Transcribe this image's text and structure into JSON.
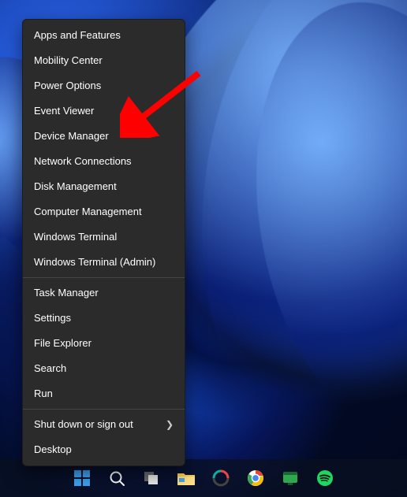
{
  "menu": {
    "group1": [
      {
        "label": "Apps and Features",
        "name": "menu-apps-features"
      },
      {
        "label": "Mobility Center",
        "name": "menu-mobility-center"
      },
      {
        "label": "Power Options",
        "name": "menu-power-options"
      },
      {
        "label": "Event Viewer",
        "name": "menu-event-viewer"
      },
      {
        "label": "Device Manager",
        "name": "menu-device-manager"
      },
      {
        "label": "Network Connections",
        "name": "menu-network-connections"
      },
      {
        "label": "Disk Management",
        "name": "menu-disk-management"
      },
      {
        "label": "Computer Management",
        "name": "menu-computer-management"
      },
      {
        "label": "Windows Terminal",
        "name": "menu-windows-terminal"
      },
      {
        "label": "Windows Terminal (Admin)",
        "name": "menu-windows-terminal-admin"
      }
    ],
    "group2": [
      {
        "label": "Task Manager",
        "name": "menu-task-manager"
      },
      {
        "label": "Settings",
        "name": "menu-settings"
      },
      {
        "label": "File Explorer",
        "name": "menu-file-explorer"
      },
      {
        "label": "Search",
        "name": "menu-search"
      },
      {
        "label": "Run",
        "name": "menu-run"
      }
    ],
    "group3": [
      {
        "label": "Shut down or sign out",
        "name": "menu-shutdown-signout",
        "submenu": true
      },
      {
        "label": "Desktop",
        "name": "menu-desktop"
      }
    ]
  },
  "taskbar": {
    "items": [
      {
        "name": "start-button",
        "icon": "windows-icon"
      },
      {
        "name": "search-button",
        "icon": "search-icon"
      },
      {
        "name": "task-view-button",
        "icon": "task-view-icon"
      },
      {
        "name": "file-explorer-button",
        "icon": "folder-icon"
      },
      {
        "name": "app-button-1",
        "icon": "ring-icon"
      },
      {
        "name": "chrome-button",
        "icon": "chrome-icon"
      },
      {
        "name": "app-button-2",
        "icon": "green-panel-icon"
      },
      {
        "name": "spotify-button",
        "icon": "spotify-icon"
      }
    ]
  },
  "annotation": {
    "target": "menu-device-manager",
    "color": "#ff0000"
  }
}
